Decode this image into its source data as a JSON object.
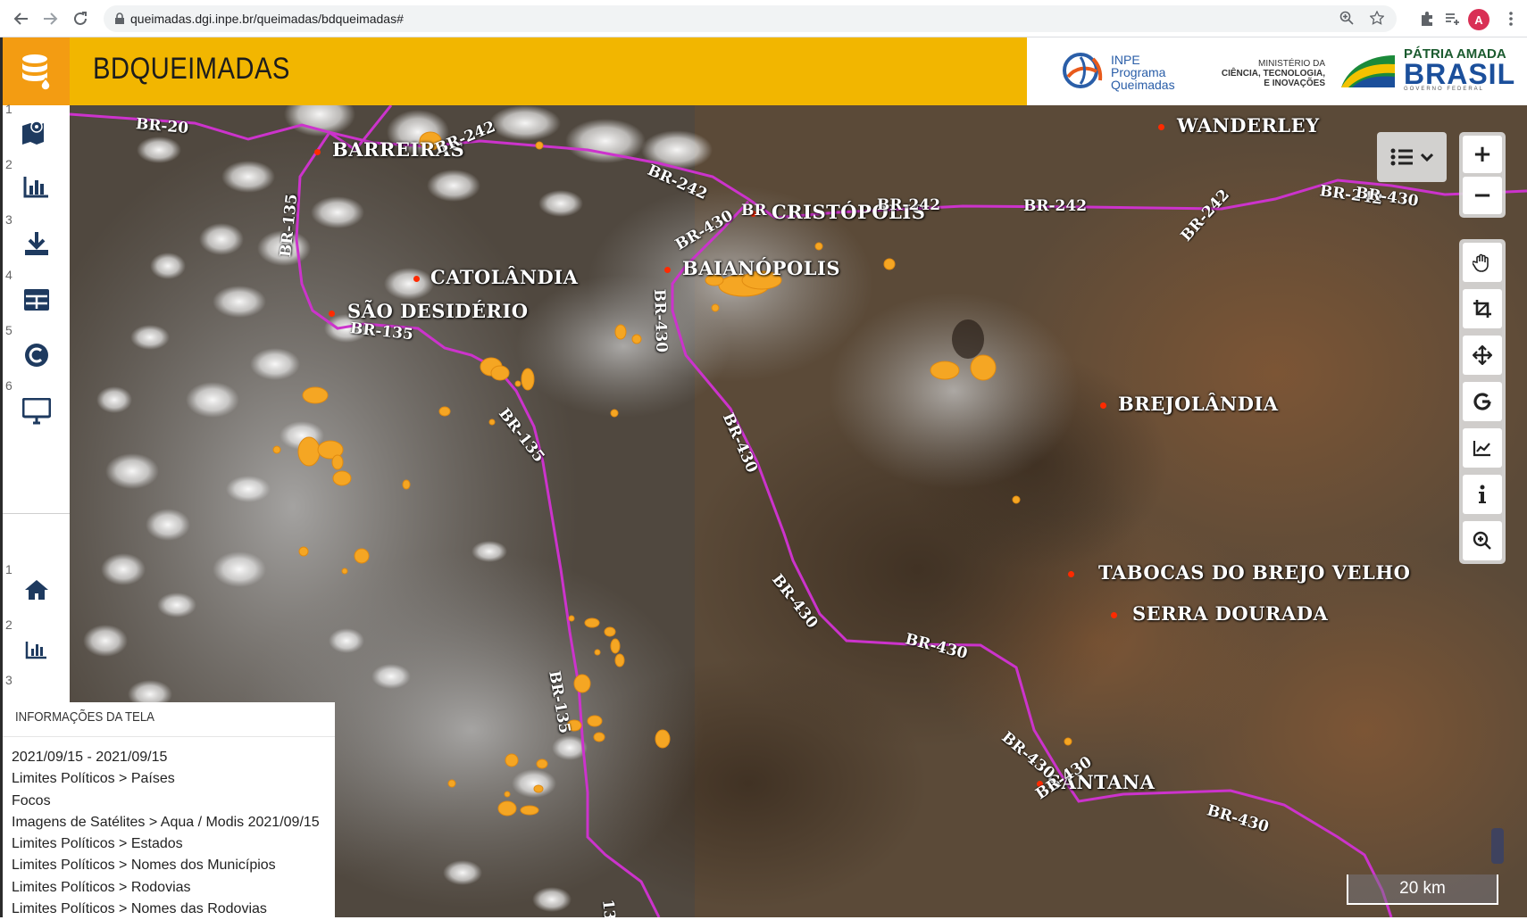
{
  "browser": {
    "url": "queimadas.dgi.inpe.br/queimadas/bdqueimadas#",
    "avatar_letter": "A"
  },
  "header": {
    "title": "BDQUEIMADAS",
    "inpe_line1": "INPE",
    "inpe_line2": "Programa",
    "inpe_line3": "Queimadas",
    "mcti_line1": "MINISTÉRIO DA",
    "mcti_line2": "CIÊNCIA, TECNOLOGIA,",
    "mcti_line3": "E INOVAÇÕES",
    "brasil_top": "PÁTRIA AMADA",
    "brasil_main": "BRASIL",
    "brasil_sub": "GOVERNO FEDERAL"
  },
  "sidebar": {
    "top_items": [
      {
        "num": "1",
        "icon": "map-marker-icon"
      },
      {
        "num": "2",
        "icon": "bar-chart-icon"
      },
      {
        "num": "3",
        "icon": "download-icon"
      },
      {
        "num": "4",
        "icon": "table-icon"
      },
      {
        "num": "5",
        "icon": "copyright-icon"
      },
      {
        "num": "6",
        "icon": "monitor-icon"
      }
    ],
    "bottom_items": [
      {
        "num": "1",
        "icon": "home-icon"
      },
      {
        "num": "2",
        "icon": "bar-chart-icon"
      },
      {
        "num": "3",
        "icon": ""
      }
    ]
  },
  "map": {
    "cities": [
      {
        "name": "WANDERLEY"
      },
      {
        "name": "BARREIRAS"
      },
      {
        "name": "CRISTÓPOLIS"
      },
      {
        "name": "BAIANÓPOLIS"
      },
      {
        "name": "CATOLÂNDIA"
      },
      {
        "name": "SÃO DESIDÉRIO"
      },
      {
        "name": "BREJOLÂNDIA"
      },
      {
        "name": "TABOCAS DO BREJO VELHO"
      },
      {
        "name": "SERRA DOURADA"
      },
      {
        "name": "SANTANA"
      }
    ],
    "roads": [
      "BR-20",
      "BR-242",
      "BR-242",
      "BR-242",
      "BR-242",
      "BR-242",
      "BR-242",
      "BR-135",
      "BR-135",
      "BR-135",
      "BR-135",
      "BR-430",
      "BR-430",
      "BR-430",
      "BR-430",
      "BR-430",
      "BR-430",
      "BR-430",
      "BR-430",
      "BR-430",
      "BR",
      "135"
    ],
    "scale": "20 km",
    "colors": {
      "fire": "#f5a623",
      "road": "#cc33cc",
      "city_dot": "#ff2a00"
    }
  },
  "tools": {
    "zoom_in": "+",
    "zoom_out": "−",
    "buttons": [
      "hand-pan-icon",
      "crop-icon",
      "move-icon",
      "google-icon",
      "line-chart-icon",
      "info-icon",
      "zoom-search-icon"
    ]
  },
  "info_panel": {
    "title": "INFORMAÇÕES DA TELA",
    "lines": [
      "2021/09/15 - 2021/09/15",
      "Limites Políticos > Países",
      "Focos",
      "Imagens de Satélites > Aqua / Modis 2021/09/15",
      "Limites Políticos > Estados",
      "Limites Políticos > Nomes dos Municípios",
      "Limites Políticos > Rodovias",
      "Limites Políticos > Nomes das Rodovias"
    ]
  }
}
